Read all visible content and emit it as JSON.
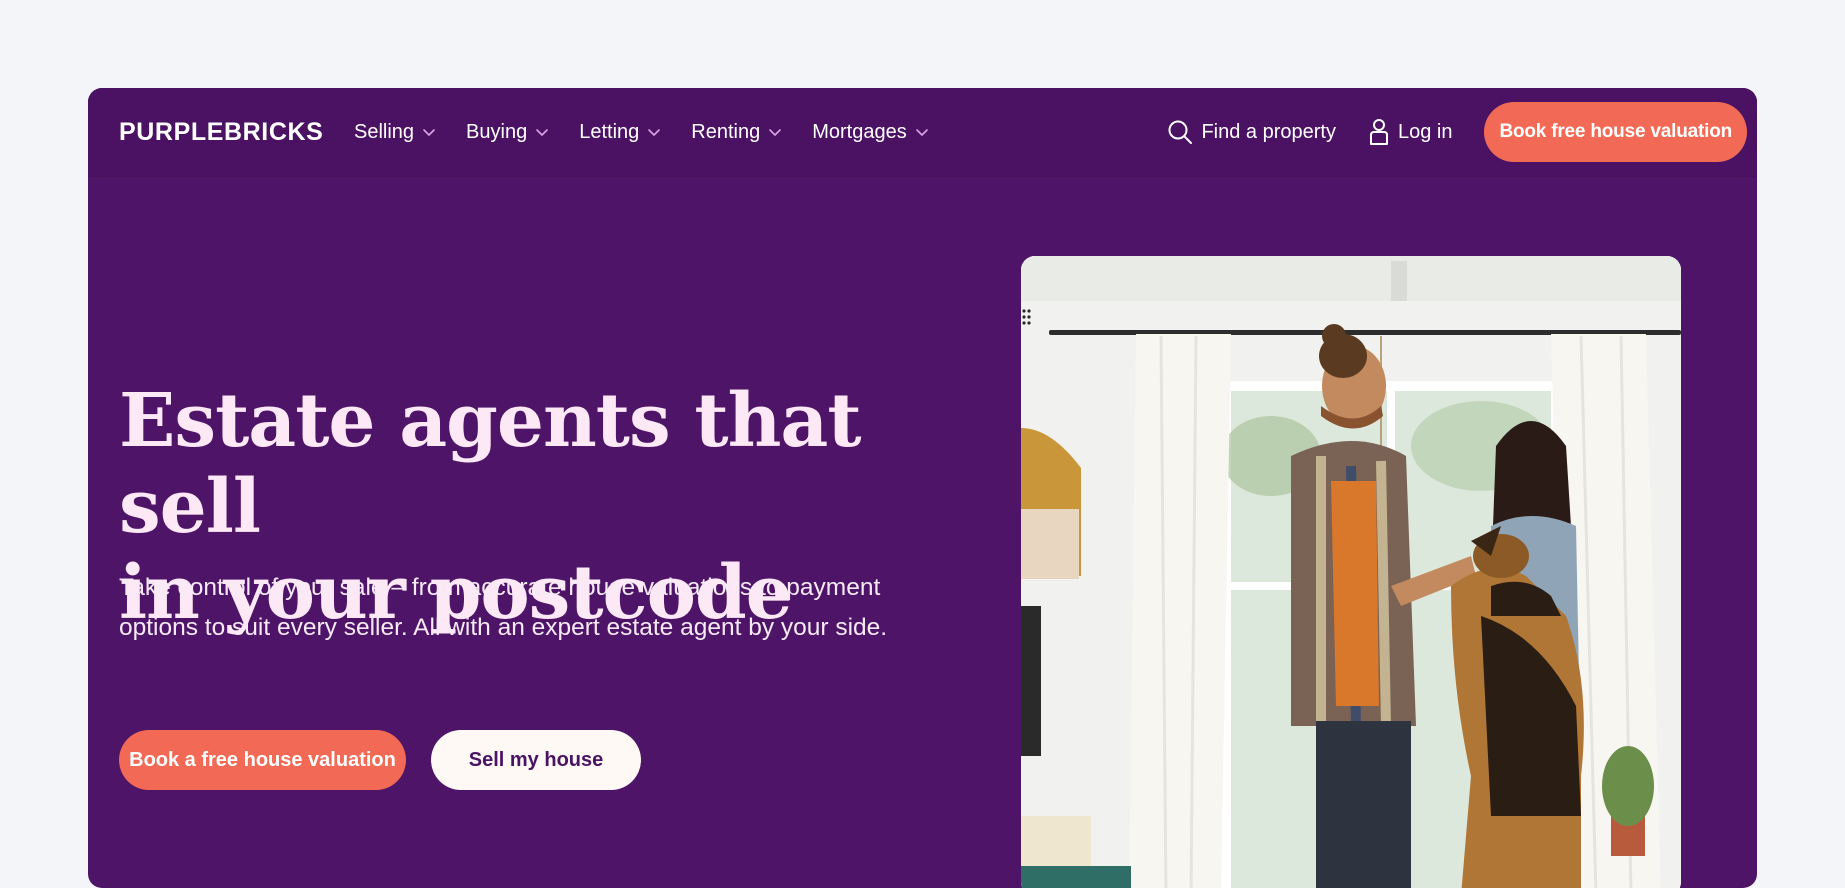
{
  "nav": {
    "logo": "PURPLEBRICKS",
    "menu": [
      {
        "label": "Selling"
      },
      {
        "label": "Buying"
      },
      {
        "label": "Letting"
      },
      {
        "label": "Renting"
      },
      {
        "label": "Mortgages"
      }
    ],
    "find_property": "Find a property",
    "login": "Log in",
    "cta": "Book free house valuation"
  },
  "hero": {
    "headline_line1": "Estate agents that sell",
    "headline_line2": "in your postcode",
    "subtext": "Take control of your sale – from accurate house valuations to payment options to suit every seller. All with an expert estate agent by your side.",
    "primary_cta": "Book a free house valuation",
    "secondary_cta": "Sell my house"
  },
  "colors": {
    "brand_purple": "#4e1467",
    "coral": "#f26a55",
    "headline": "#fde8f6",
    "page_bg": "#f4f5f9"
  },
  "icons": {
    "search": "search-icon",
    "user": "user-icon",
    "chevron": "chevron-down-icon"
  }
}
